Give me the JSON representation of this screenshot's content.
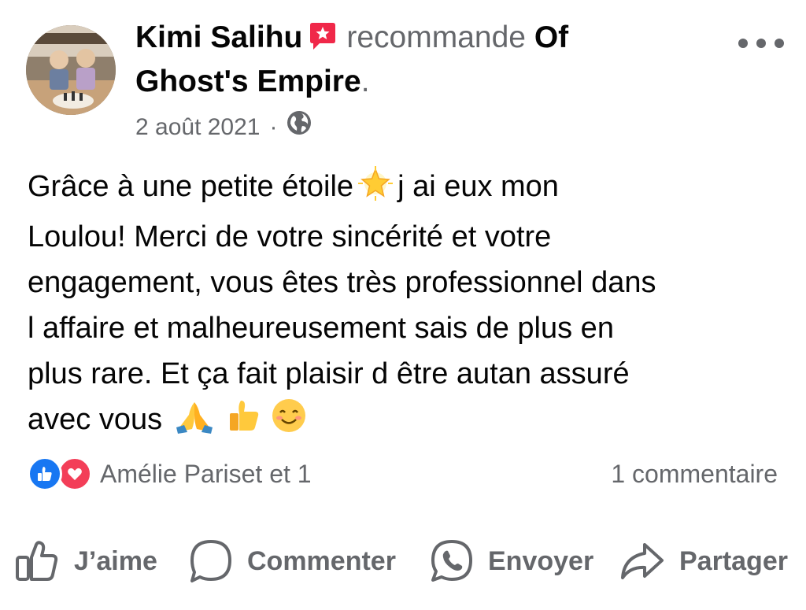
{
  "post": {
    "author": "Kimi Salihu",
    "verb": "recommande",
    "page_line1": "Of",
    "page_line2": "Ghost's Empire",
    "period": ".",
    "date": "2 août 2021",
    "separator": "·",
    "privacy_icon": "globe-icon",
    "text_lines": {
      "l1a": "Grâce à une petite étoile",
      "l1b": "j ai eux mon",
      "l2": "Loulou! Merci de votre sincérité et votre",
      "l3": "engagement, vous êtes très professionnel dans",
      "l4": "l affaire et malheureusement sais de plus en",
      "l5": "plus rare. Et ça fait plaisir d être autan assuré",
      "l6": "avec vous"
    }
  },
  "reactions": {
    "names": "Amélie Pariset et 1",
    "comments": "1 commentaire",
    "icons": [
      "like-icon",
      "love-icon"
    ]
  },
  "actions": {
    "like": "J’aime",
    "comment": "Commenter",
    "send": "Envoyer",
    "share": "Partager"
  },
  "colors": {
    "text": "#050505",
    "secondary": "#65676b",
    "like_blue": "#1877f2",
    "love_red": "#f33e58",
    "recommend_badge": "#f02849"
  }
}
